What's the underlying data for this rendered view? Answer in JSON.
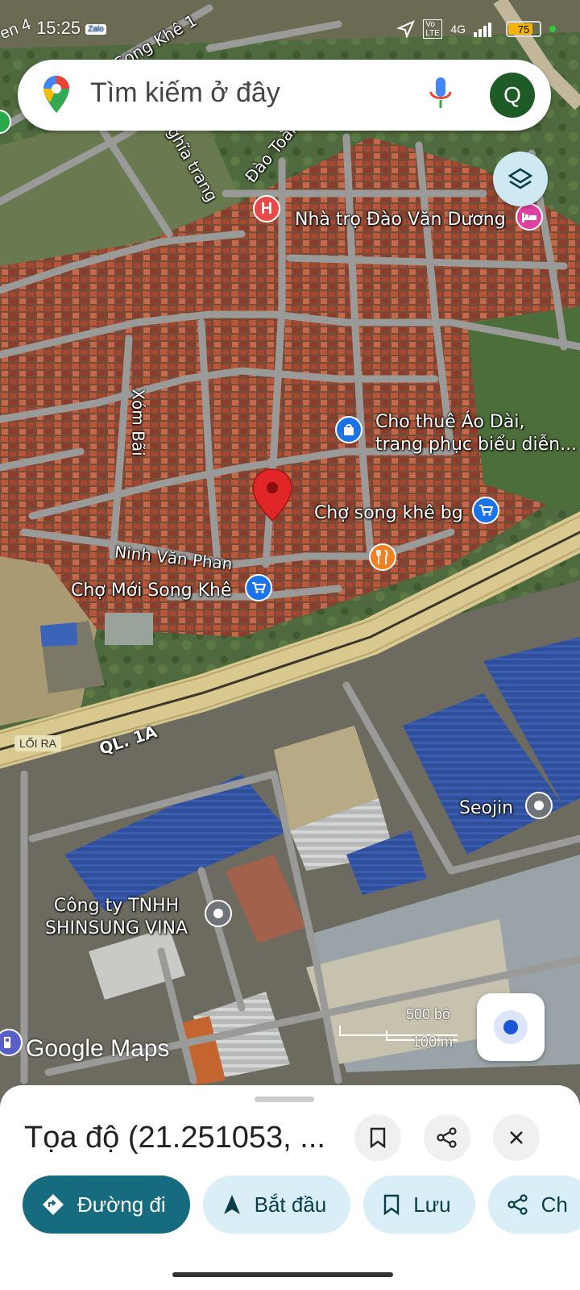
{
  "status": {
    "time": "15:25",
    "left_fragment": "en 4",
    "app_badge": "Zalo",
    "network": "4G",
    "volte": "Vo LTE",
    "battery": "75",
    "battery_level": 0.75
  },
  "search": {
    "placeholder": "Tìm kiếm ở đây",
    "avatar_letter": "Q"
  },
  "map": {
    "roads": {
      "song_khe_1": "Song Khê 1",
      "nghia_trang": "nghĩa trang",
      "dao_toan": "Đào Toàn",
      "xom_bai": "Xóm Bãi",
      "ninh_van_phan": "Ninh Văn Phan",
      "ql1a": "QL. 1A",
      "exit": "LỐI RA"
    },
    "pois": {
      "nha_tro": "Nhà trọ Đào Văn Dương",
      "ao_dai_line1": "Cho thuê Áo Dài,",
      "ao_dai_line2": "trang phục biểu diễn...",
      "cho_song_khe": "Chợ song khê bg",
      "cho_moi": "Chợ Mới Song Khê",
      "seojin": "Seojin",
      "shinsung_line1": "Công ty TNHH",
      "shinsung_line2": "SHINSUNG VINA",
      "hospital_letter": "H"
    },
    "logo": "Google Maps",
    "scale_top": "500 bộ",
    "scale_bottom": "100 m",
    "colors": {
      "pin": "#e02626",
      "poi_blue": "#1a73e8",
      "poi_orange": "#f08022",
      "poi_pink": "#e040a0",
      "highway": "#c9b36a"
    }
  },
  "sheet": {
    "title": "Tọa độ (21.251053, ...",
    "chips": {
      "directions": "Đường đi",
      "start": "Bắt đầu",
      "save": "Lưu",
      "share": "Ch"
    }
  }
}
